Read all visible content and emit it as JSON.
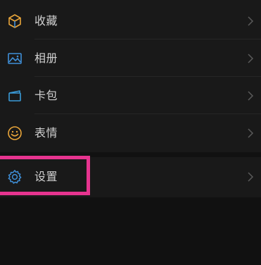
{
  "menu": {
    "items": [
      {
        "label": "收藏",
        "icon": "cube-icon",
        "icon_color": "#e8a53a"
      },
      {
        "label": "相册",
        "icon": "photo-icon",
        "icon_color": "#3f8fd8"
      },
      {
        "label": "卡包",
        "icon": "card-icon",
        "icon_color": "#3a9bd8"
      },
      {
        "label": "表情",
        "icon": "smiley-icon",
        "icon_color": "#e8a53a"
      }
    ],
    "settings": {
      "label": "设置",
      "icon": "gear-icon",
      "icon_color": "#3f8fd8"
    }
  },
  "colors": {
    "background": "#111111",
    "row_background": "#191919",
    "text": "#d0d0d0",
    "chevron": "#5a5a5a",
    "highlight": "#e6348f"
  }
}
